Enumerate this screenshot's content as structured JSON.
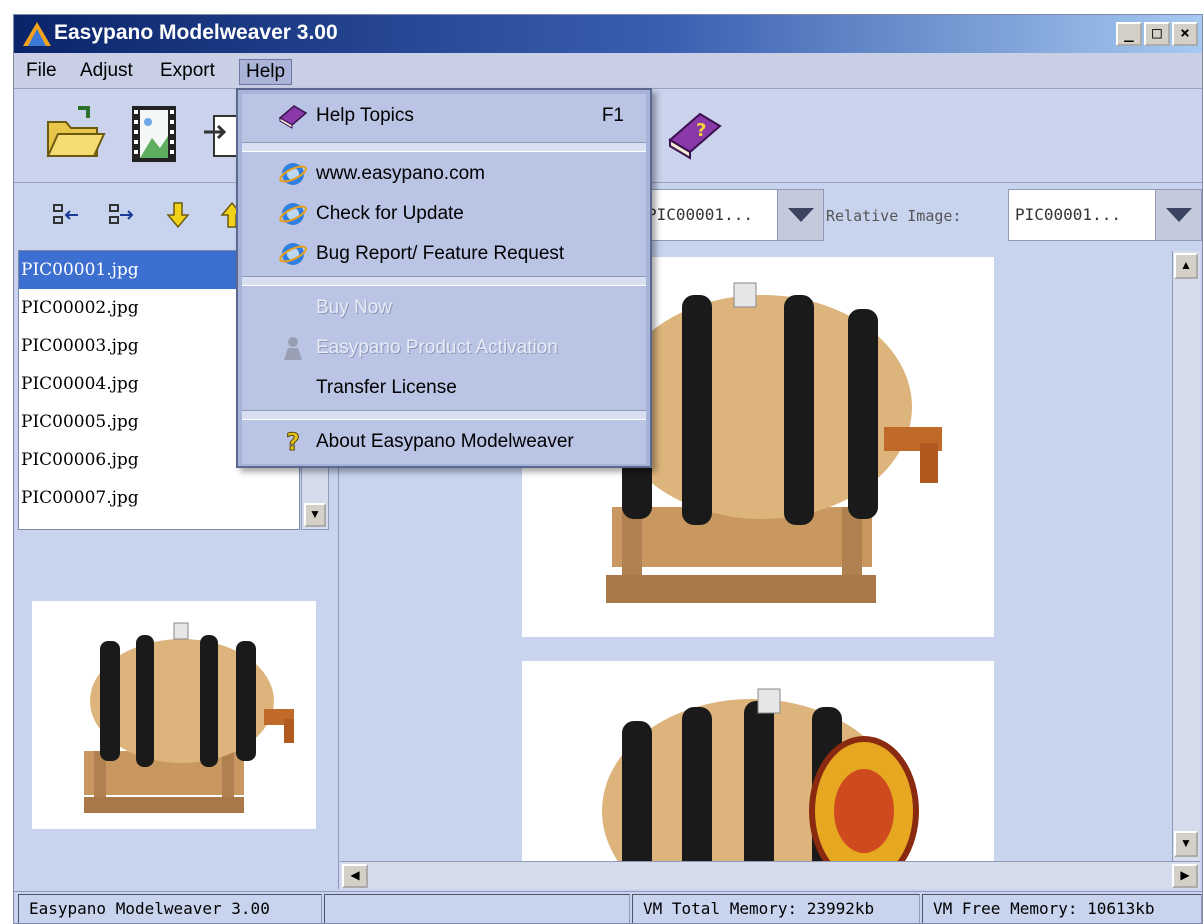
{
  "window": {
    "title": "Easypano Modelweaver 3.00",
    "controls": {
      "minimize": "_",
      "maximize": "□",
      "close": "×"
    }
  },
  "menubar": {
    "items": [
      {
        "label": "File"
      },
      {
        "label": "Adjust"
      },
      {
        "label": "Export"
      },
      {
        "label": "Help"
      }
    ]
  },
  "toolbar": {
    "buttons": [
      "open-folder-icon",
      "image-film-icon",
      "export-icon",
      "help-book-icon"
    ]
  },
  "file_list": {
    "selected": "PIC00001.jpg",
    "items": [
      "PIC00001.jpg",
      "PIC00002.jpg",
      "PIC00003.jpg",
      "PIC00004.jpg",
      "PIC00005.jpg",
      "PIC00006.jpg",
      "PIC00007.jpg"
    ]
  },
  "image_panel": {
    "current_image_value": "PIC00001...",
    "relative_label": "Relative Image:",
    "relative_image_value": "PIC00001..."
  },
  "help_menu": {
    "sections": [
      [
        {
          "label": "Help Topics",
          "shortcut": "F1",
          "icon": "help-book-icon",
          "enabled": true
        }
      ],
      [
        {
          "label": "www.easypano.com",
          "icon": "ie-globe-icon",
          "enabled": true
        },
        {
          "label": "Check for Update",
          "icon": "ie-globe-icon",
          "enabled": true
        },
        {
          "label": "Bug Report/ Feature Request",
          "icon": "ie-globe-icon",
          "enabled": true
        }
      ],
      [
        {
          "label": "Buy Now",
          "enabled": false
        },
        {
          "label": "Easypano Product Activation",
          "icon": "activation-icon",
          "enabled": false
        },
        {
          "label": "Transfer License",
          "enabled": true
        }
      ],
      [
        {
          "label": "About Easypano Modelweaver",
          "icon": "question-bulb-icon",
          "enabled": true
        }
      ]
    ]
  },
  "statusbar": {
    "app": "Easypano Modelweaver 3.00",
    "vm_total": "VM Total Memory: 23992kb",
    "vm_free": "VM Free Memory: 10613kb"
  },
  "colors": {
    "title_start": "#0a246a",
    "menu_bg": "#a7b4da",
    "selection": "#3d6fd0",
    "barrel_wood": "#d8b27a",
    "barrel_hoop": "#1a1a1a"
  }
}
